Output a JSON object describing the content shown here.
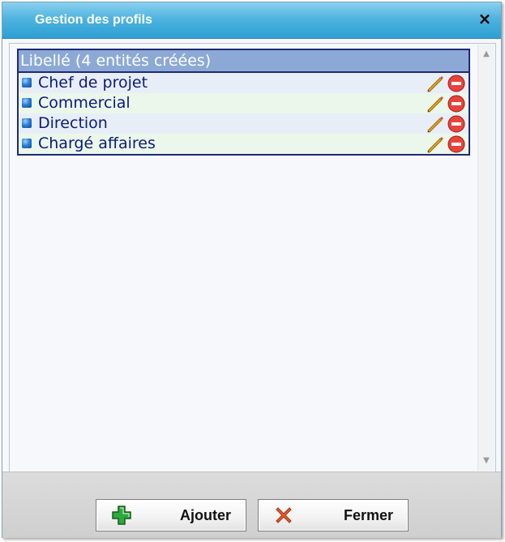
{
  "dialog": {
    "title": "Gestion des profils",
    "close_symbol": "×"
  },
  "grid": {
    "header": "Libellé (4 entités créées)",
    "rows": [
      {
        "label": "Chef de projet"
      },
      {
        "label": "Commercial"
      },
      {
        "label": "Direction"
      },
      {
        "label": "Chargé affaires"
      }
    ],
    "row_icons": {
      "edit": "pencil-icon",
      "delete": "delete-icon"
    }
  },
  "buttons": {
    "add_label": "Ajouter",
    "close_label": "Fermer"
  },
  "colors": {
    "titlebar": "#2c9fd3",
    "grid_header": "#8ca9d6",
    "row_text": "#0c1a7e",
    "grid_border": "#1f2a76"
  }
}
